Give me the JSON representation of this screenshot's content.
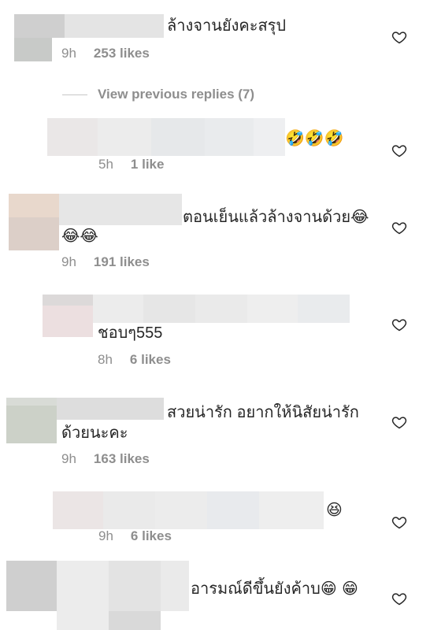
{
  "comments": [
    {
      "text": "ล้างจานยังคะสรุป",
      "time": "9h",
      "likes": "253 likes"
    },
    {
      "text": "🤣🤣🤣",
      "time": "5h",
      "likes": "1 like"
    },
    {
      "text_line1": "ตอนเย็นแล้วล้างจานด้วย😂",
      "text_line2": "😂😂",
      "time": "9h",
      "likes": "191 likes"
    },
    {
      "text": "ชอบๆ555",
      "time": "8h",
      "likes": "6 likes"
    },
    {
      "text_line1": "สวยน่ารัก อยากให้นิสัยน่ารัก",
      "text_line2": "ด้วยนะคะ",
      "time": "9h",
      "likes": "163 likes"
    },
    {
      "text": "😆",
      "time": "9h",
      "likes": "6 likes"
    },
    {
      "text": "อารมณ์ดีขึ้นยังค้าบ😁 😁"
    }
  ],
  "view_replies": "View previous replies (7)",
  "icons": {
    "heart": "heart-outline-icon"
  }
}
